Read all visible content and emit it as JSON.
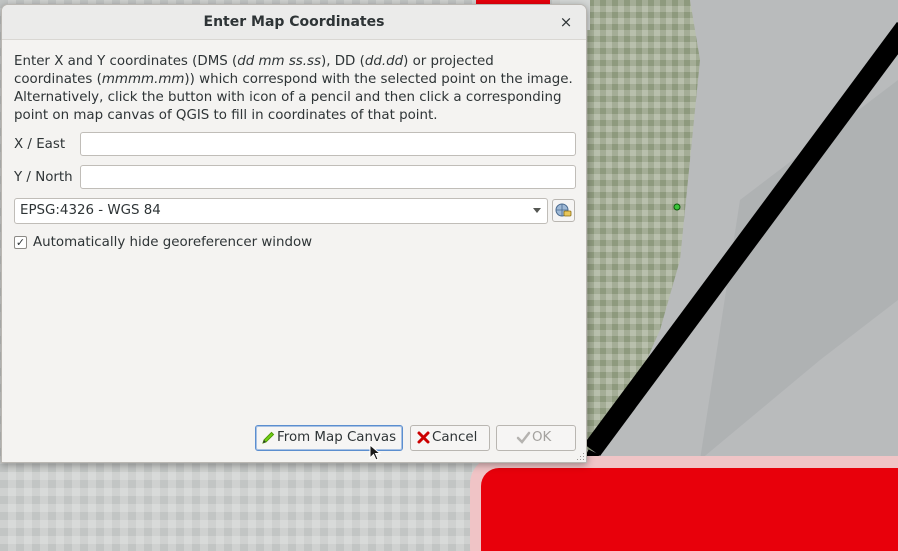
{
  "dialog": {
    "title": "Enter Map Coordinates",
    "close_symbol": "×",
    "instructions": {
      "p1": "Enter X and Y coordinates (DMS (",
      "i1": "dd mm ss.ss",
      "p2": "), DD (",
      "i2": "dd.dd",
      "p3": ") or projected coordinates (",
      "i3": "mmmm.mm",
      "p4": ")) which correspond with the selected point on the image. Alternatively, click the button with icon of a pencil and then click a corresponding point on map canvas of QGIS to fill in coordinates of that point."
    },
    "x_label": "X / East",
    "x_value": "",
    "y_label": "Y / North",
    "y_value": "",
    "crs_selected": "EPSG:4326 - WGS 84",
    "auto_hide_label": "Automatically hide georeferencer window",
    "auto_hide_checked": "✓",
    "buttons": {
      "from_canvas": "From Map Canvas",
      "cancel": "Cancel",
      "ok": "OK"
    }
  },
  "icons": {
    "close": "close-icon",
    "crs": "projection-select-icon",
    "pencil": "pencil-icon",
    "cancel": "cancel-icon",
    "ok": "ok-icon"
  },
  "colors": {
    "accent": "#5b8ecf",
    "map_line": "#000000",
    "map_red": "#e8000b",
    "cancel_red": "#cc0000",
    "pencil_green": "#4e9a06"
  }
}
